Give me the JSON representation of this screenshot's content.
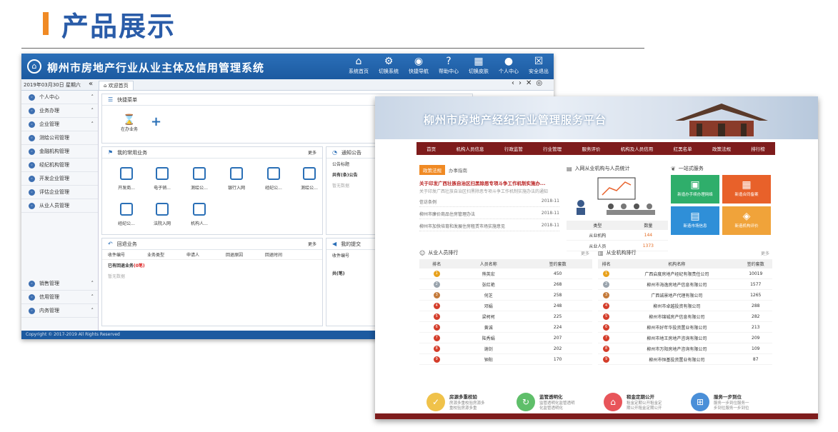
{
  "page_title": "产品展示",
  "colors": {
    "accent": "#f08a24",
    "title_blue": "#2a5ca8",
    "nav_blue": "#1c5aa0",
    "portal_red": "#7e1c1c"
  },
  "back_app": {
    "title": "柳州市房地产行业从业主体及信用管理系统",
    "nav": [
      {
        "icon": "home-icon",
        "label": "系统首页"
      },
      {
        "icon": "gear-icon",
        "label": "切换系统"
      },
      {
        "icon": "compass-icon",
        "label": "快捷导航"
      },
      {
        "icon": "help-icon",
        "label": "帮助中心"
      },
      {
        "icon": "grid-icon",
        "label": "切换皮肤"
      },
      {
        "icon": "user-icon",
        "label": "个人中心"
      },
      {
        "icon": "exit-icon",
        "label": "安全退出"
      }
    ],
    "date": "2019年03月30日 星期六",
    "tab": "欢迎首页",
    "sidebar": [
      "个人中心",
      "业务办理",
      "企业管理",
      "测绘公司管理",
      "金融机构管理",
      "经纪机构管理",
      "开发企业管理",
      "评估企业管理",
      "从业人员管理"
    ],
    "sidebar_bottom": [
      "销售管理",
      "信用管理",
      "内务管理"
    ],
    "quick_menu": {
      "title": "快捷菜单",
      "item": "在办业务"
    },
    "common_biz": {
      "title": "我的常用业务",
      "more": "更多",
      "items": [
        "开发商...",
        "电子销...",
        "测绘公...",
        "银行入网",
        "经纪公...",
        "测绘公...",
        "经纪公...",
        "法院入网",
        "机构人..."
      ]
    },
    "notice": {
      "title": "通知公告",
      "col": "公告标题",
      "count": "共有(条)公告",
      "empty": "暂无数据"
    },
    "returned": {
      "title": "回退业务",
      "more": "更多",
      "cols": [
        "收件编号",
        "业务类型",
        "申请人",
        "回退原因",
        "回退时间"
      ],
      "summary_prefix": "已有回退业务",
      "summary_count": "(0笔)",
      "empty": "暂无数据"
    },
    "submitted": {
      "title": "我的提交",
      "col": "收件编号",
      "col2": "业",
      "count": "共(笔)"
    },
    "footer": "Copyright © 2017-2019 All Rights Reserved"
  },
  "front_app": {
    "title": "柳州市房地产经纪行业管理服务平台",
    "menu": [
      "首页",
      "机构人员信息",
      "行政监管",
      "行业管理",
      "服务评价",
      "机构及人员信用",
      "红黑名单",
      "政策法规",
      "排行榜"
    ],
    "news_tabs": [
      "政策法规",
      "办事指南"
    ],
    "news_headline": "关于印发广西壮族自治区扫黑除恶专项斗争工作机制实施办...",
    "news_desc": "关于印发广西壮族自治区扫黑除恶专项斗争工作机制实施办法的通知",
    "news_list": [
      {
        "t": "信访条例",
        "d": "2018-11"
      },
      {
        "t": "柳州市廉价商品住房管理办法",
        "d": "2018-11"
      },
      {
        "t": "柳州市加快培育和发展住房租赁市场实施意见",
        "d": "2018-11"
      }
    ],
    "stats": {
      "title": "入网从业机构与人员统计",
      "h1": "类型",
      "h2": "数量",
      "rows": [
        {
          "k": "从业机构",
          "v": "144"
        },
        {
          "k": "从业人员",
          "v": "1373"
        }
      ]
    },
    "services": {
      "title": "一站式服务",
      "tiles": [
        {
          "label": "新造办手续办理网络",
          "color": "#2fae6b",
          "icon": "id-card-icon"
        },
        {
          "label": "新造合同备案",
          "color": "#e8612a",
          "icon": "contract-icon"
        },
        {
          "label": "新造市场信息",
          "color": "#2f8fd8",
          "icon": "document-icon"
        },
        {
          "label": "新造机构评价",
          "color": "#f0a33a",
          "icon": "evaluate-icon"
        }
      ]
    },
    "person_rank": {
      "title": "从业人员排行",
      "more": "更多",
      "cols": [
        "排名",
        "人员名称",
        "签约套数"
      ],
      "rows": [
        [
          "1",
          "熊英宏",
          "450"
        ],
        [
          "2",
          "张红艳",
          "268"
        ],
        [
          "3",
          "何芝",
          "258"
        ],
        [
          "4",
          "邓娟",
          "248"
        ],
        [
          "5",
          "梁柯柯",
          "225"
        ],
        [
          "6",
          "黄诚",
          "224"
        ],
        [
          "7",
          "陆秀娟",
          "207"
        ],
        [
          "8",
          "谢剑",
          "202"
        ],
        [
          "9",
          "钟阳",
          "170"
        ]
      ]
    },
    "org_rank": {
      "title": "从业机构排行",
      "more": "更多",
      "cols": [
        "排名",
        "机构名称",
        "签约套数"
      ],
      "rows": [
        [
          "1",
          "广西启度房地产经纪有限责任公司",
          "10019"
        ],
        [
          "2",
          "柳州市海逸房地产信息有限公司",
          "1577"
        ],
        [
          "3",
          "广西诚景地产代理有限公司",
          "1265"
        ],
        [
          "4",
          "柳州市卓越投资有限公司",
          "288"
        ],
        [
          "5",
          "柳州市锦城房产信息有限公司",
          "282"
        ],
        [
          "6",
          "柳州市好年华投资置业有限公司",
          "213"
        ],
        [
          "7",
          "柳州市地王房地产咨询有限公司",
          "209"
        ],
        [
          "8",
          "柳州市万阳房地产咨询有限公司",
          "109"
        ],
        [
          "9",
          "柳州市恒基投资置业有限公司",
          "87"
        ]
      ]
    },
    "features": [
      {
        "title": "房源多重校验",
        "desc1": "房源多重校验房源多",
        "desc2": "重校验房源多重",
        "color": "#f0c24a",
        "icon": "shield-check-icon"
      },
      {
        "title": "监管透明化",
        "desc1": "监管透明化监管透明",
        "desc2": "化监管透明化",
        "color": "#5fbf6a",
        "icon": "recycle-icon"
      },
      {
        "title": "租金定期公开",
        "desc1": "租金定期公开租金定",
        "desc2": "期公开租金定期公开",
        "color": "#e8555a",
        "icon": "house-icon"
      },
      {
        "title": "服务一步到位",
        "desc1": "服务一步到位服务一",
        "desc2": "步到位服务一步到位",
        "color": "#4a8fd8",
        "icon": "network-icon"
      }
    ]
  }
}
